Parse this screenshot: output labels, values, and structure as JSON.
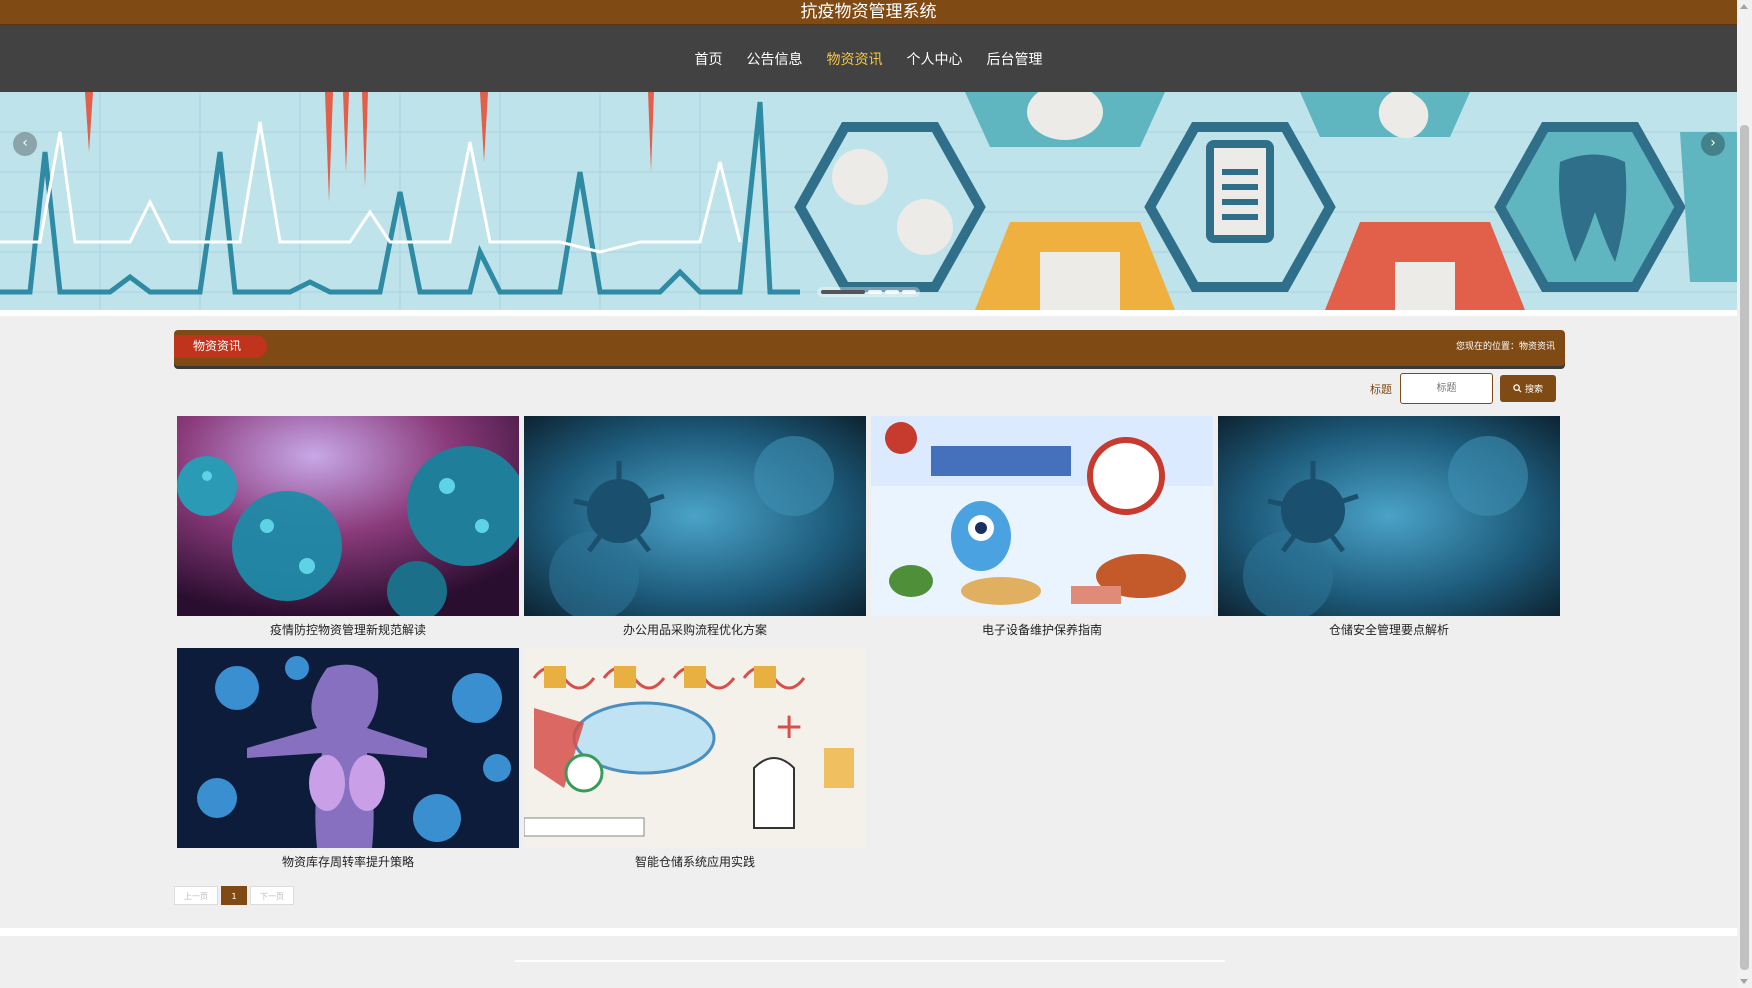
{
  "site": {
    "title": "抗疫物资管理系统"
  },
  "nav": {
    "items": [
      {
        "label": "首页"
      },
      {
        "label": "公告信息"
      },
      {
        "label": "物资资讯"
      },
      {
        "label": "个人中心"
      },
      {
        "label": "后台管理"
      }
    ],
    "active_index": 2
  },
  "carousel": {
    "prev_icon": "chevron-left-icon",
    "next_icon": "chevron-right-icon",
    "slide_count": 4,
    "active_slide": 0
  },
  "section": {
    "tab_label": "物资资讯",
    "breadcrumb_prefix": "您现在的位置：",
    "breadcrumb_current": "物资资讯"
  },
  "search": {
    "label": "标题",
    "placeholder": "标题",
    "button_label": "搜索",
    "button_icon": "search-icon"
  },
  "cards": [
    {
      "title": "疫情防控物资管理新规范解读"
    },
    {
      "title": "办公用品采购流程优化方案"
    },
    {
      "title": "电子设备维护保养指南"
    },
    {
      "title": "仓储安全管理要点解析"
    },
    {
      "title": "物资库存周转率提升策略"
    },
    {
      "title": "智能仓储系统应用实践"
    }
  ],
  "pagination": {
    "prev_label": "上一页",
    "current_page": "1",
    "next_label": "下一页"
  },
  "colors": {
    "brand": "#7f4a14",
    "nav_bg": "#424242",
    "active_nav": "#f5c542",
    "tab_red": "#c0341d"
  }
}
